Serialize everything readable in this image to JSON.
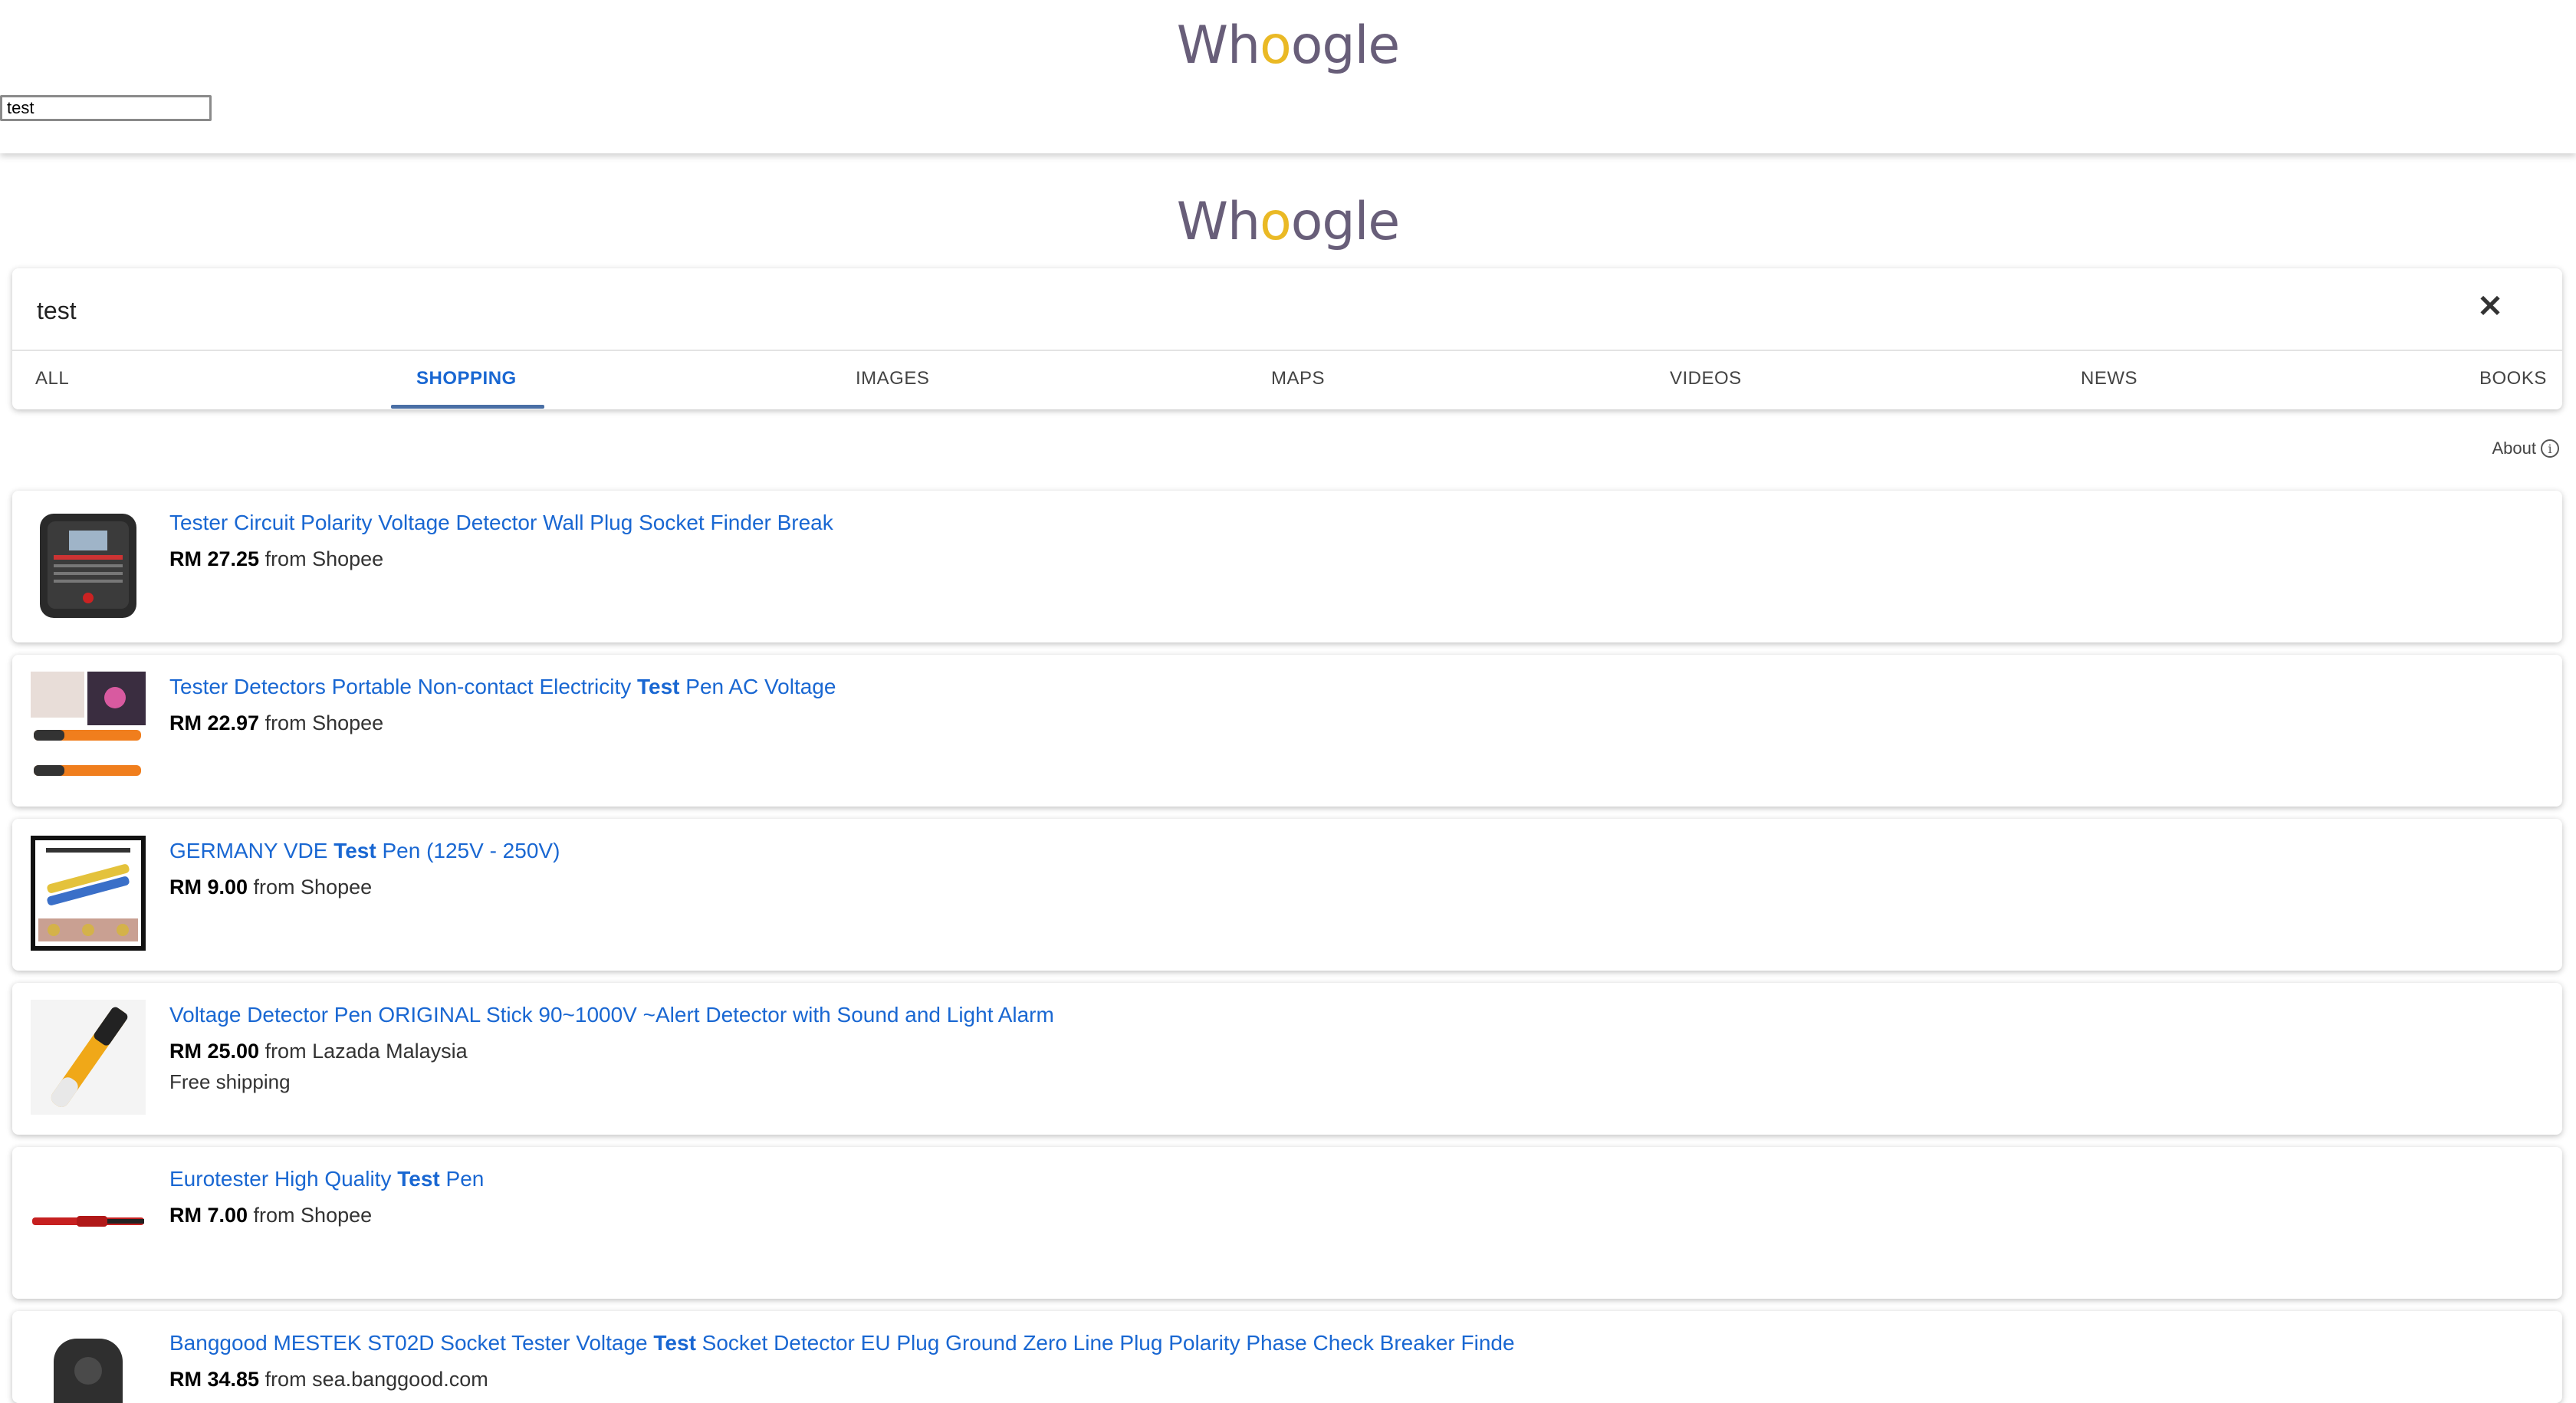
{
  "top_header": {
    "logo": "Whoogle",
    "search_value": "test"
  },
  "main_logo": "Whoogle",
  "search": {
    "value": "test",
    "clear_icon": "close-icon"
  },
  "tabs": [
    {
      "label": "ALL",
      "active": false
    },
    {
      "label": "SHOPPING",
      "active": true
    },
    {
      "label": "IMAGES",
      "active": false
    },
    {
      "label": "MAPS",
      "active": false
    },
    {
      "label": "VIDEOS",
      "active": false
    },
    {
      "label": "NEWS",
      "active": false
    },
    {
      "label": "BOOKS",
      "active": false
    }
  ],
  "about": {
    "label": "About",
    "icon": "info-icon"
  },
  "results": [
    {
      "title_pre": "Tester Circuit Polarity Voltage Detector Wall Plug Socket Finder Break",
      "title_bold": "",
      "title_post": "",
      "price": "RM 27.25",
      "source": " from Shopee",
      "extra": ""
    },
    {
      "title_pre": "Tester Detectors Portable Non-contact Electricity ",
      "title_bold": "Test",
      "title_post": " Pen AC Voltage",
      "price": "RM 22.97",
      "source": " from Shopee",
      "extra": ""
    },
    {
      "title_pre": "GERMANY VDE ",
      "title_bold": "Test",
      "title_post": " Pen (125V - 250V)",
      "price": "RM 9.00",
      "source": " from Shopee",
      "extra": ""
    },
    {
      "title_pre": "Voltage Detector Pen ORIGINAL Stick 90~1000V ~Alert Detector with Sound and Light Alarm",
      "title_bold": "",
      "title_post": "",
      "price": "RM 25.00",
      "source": " from Lazada Malaysia",
      "extra": "Free shipping"
    },
    {
      "title_pre": "Eurotester High Quality ",
      "title_bold": "Test",
      "title_post": " Pen",
      "price": "RM 7.00",
      "source": " from Shopee",
      "extra": ""
    },
    {
      "title_pre": "Banggood MESTEK ST02D Socket Tester Voltage ",
      "title_bold": "Test",
      "title_post": " Socket Detector EU Plug Ground Zero Line Plug Polarity Phase Check Breaker Finde",
      "price": "RM 34.85",
      "source": " from sea.banggood.com",
      "extra": ""
    }
  ]
}
